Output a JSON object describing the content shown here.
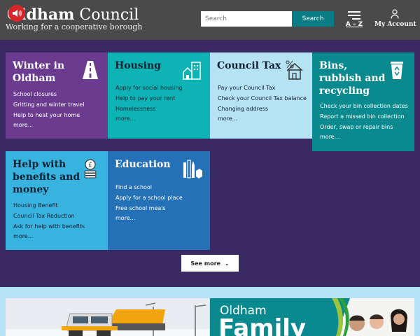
{
  "header": {
    "logo_bold": "Oldham",
    "logo_rest": " Council",
    "tagline": "Working for a cooperative borough",
    "search_placeholder": "Search",
    "search_button": "Search",
    "az_label": "A – Z",
    "account_label": "My Account"
  },
  "tiles": [
    {
      "title": "Winter in\nOldham",
      "icon": "road-icon",
      "links": [
        "School closures",
        "Gritting and winter travel",
        "Help to heat your home"
      ],
      "more": "more..."
    },
    {
      "title": "Housing",
      "icon": "houses-icon",
      "links": [
        "Apply for social housing",
        "Help to pay your rent",
        "Homelessness"
      ],
      "more": "more..."
    },
    {
      "title": "Council Tax",
      "icon": "house-percent-icon",
      "links": [
        "Pay your Council Tax",
        "Check your Council Tax balance",
        "Changing address"
      ],
      "more": "more..."
    },
    {
      "title": "Bins,\nrubbish and\nrecycling",
      "icon": "recycle-bin-icon",
      "links": [
        "Check your bin collection dates",
        "Report a missed bin collection",
        "Order, swap or repair bins"
      ],
      "more": "more..."
    },
    {
      "title": "Help with\nbenefits and\nmoney",
      "icon": "coins-icon",
      "links": [
        "Housing Benefit",
        "Council Tax Reduction",
        "Ask for help with benefits"
      ],
      "more": "more..."
    },
    {
      "title": "Education",
      "icon": "pencils-ruler-icon",
      "links": [
        "Find a school",
        "Apply for a school place",
        "Free school meals"
      ],
      "more": "more..."
    }
  ],
  "see_more": "See more",
  "promo": {
    "right_line1": "Oldham",
    "right_line2": "Family"
  },
  "colors": {
    "header_bg": "#4a4a4a",
    "page_bg": "#3a2a63",
    "search_button": "#097d83",
    "winter": "#6b3b8f",
    "housing": "#0db3b5",
    "tax": "#b6e3f4",
    "bins": "#0a8a8e",
    "help": "#38b2de",
    "education": "#2471b7"
  }
}
